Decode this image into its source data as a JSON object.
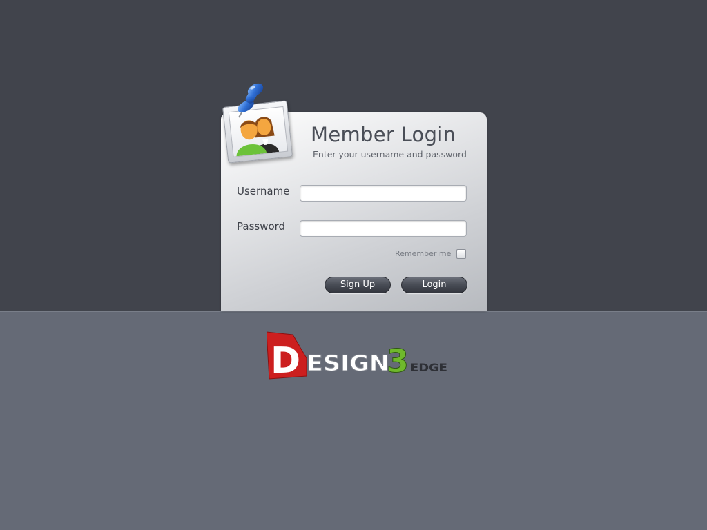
{
  "login": {
    "title": "Member Login",
    "subtitle": "Enter your username and password",
    "username_label": "Username",
    "username_value": "",
    "password_label": "Password",
    "password_value": "",
    "remember_label": "Remember me",
    "remember_checked": false,
    "signup_label": "Sign Up",
    "login_label": "Login"
  },
  "icons": {
    "pin": "pushpin-icon",
    "users": "users-icon"
  },
  "logo": {
    "main_text": "ESIGN",
    "letter_d": "D",
    "digit": "3",
    "suffix": "EDGE"
  },
  "colors": {
    "top_background": "#41444c",
    "bottom_background": "#656a76",
    "logo_red": "#cc1f1f",
    "logo_green": "#6fb82c"
  }
}
